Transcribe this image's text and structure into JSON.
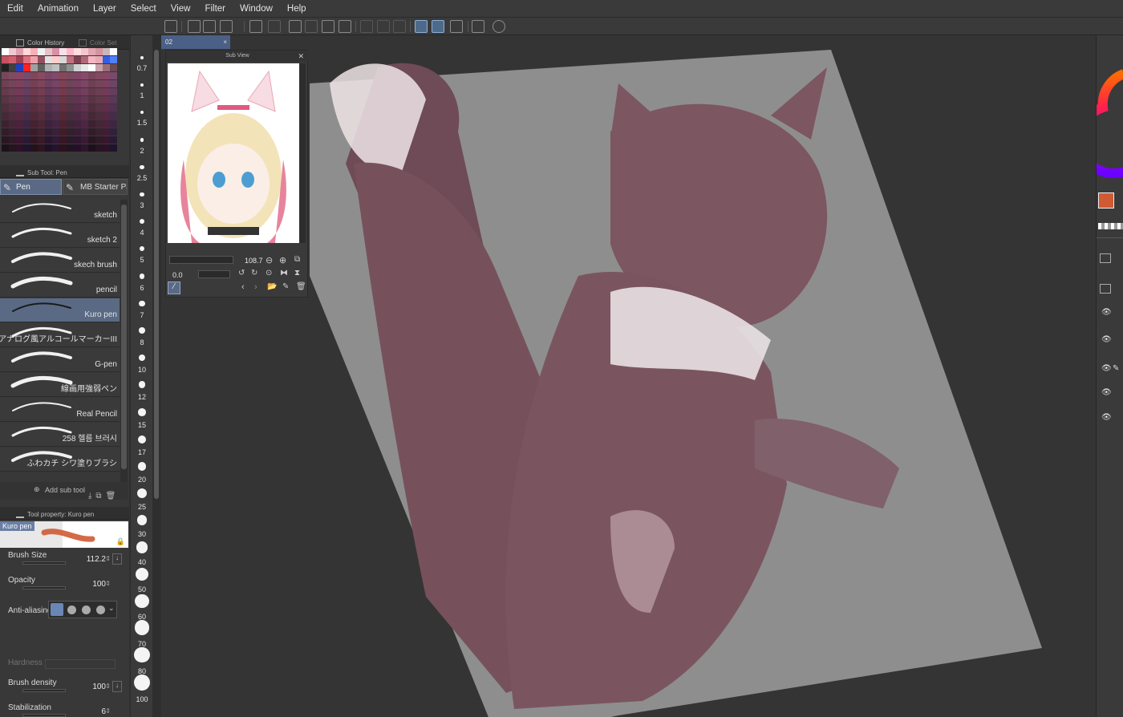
{
  "menu": {
    "items": [
      "Edit",
      "Animation",
      "Layer",
      "Select",
      "View",
      "Filter",
      "Window",
      "Help"
    ]
  },
  "left_panel": {
    "color_history_tab": "Color History",
    "color_set_tab": "Color Set",
    "subtool_header": "Sub Tool: Pen",
    "subtool_groups": [
      "Pen",
      "MB Starter Pa"
    ],
    "brushes": [
      {
        "label": "sketch"
      },
      {
        "label": "sketch 2"
      },
      {
        "label": "skech brush"
      },
      {
        "label": "pencil"
      },
      {
        "label": "Kuro pen"
      },
      {
        "label": "アナログ風アルコールマーカーIII"
      },
      {
        "label": "G-pen"
      },
      {
        "label": "線画用強弱ペン"
      },
      {
        "label": "Real Pencil"
      },
      {
        "label": "258 헬름 브러시"
      },
      {
        "label": "ふわカチ シワ塗りブラシ"
      }
    ],
    "selected_brush_index": 4,
    "add_subtool_label": "Add sub tool",
    "tool_property_header": "Tool property: Kuro pen",
    "preview_label": "Kuro pen",
    "properties": {
      "brush_size": {
        "label": "Brush Size",
        "value": "112.2"
      },
      "opacity": {
        "label": "Opacity",
        "value": "100"
      },
      "anti_aliasing": {
        "label": "Anti-aliasing"
      },
      "hardness": {
        "label": "Hardness"
      },
      "brush_density": {
        "label": "Brush density",
        "value": "100"
      },
      "stabilization": {
        "label": "Stabilization",
        "value": "6"
      }
    }
  },
  "size_column": {
    "values": [
      "0.7",
      "1",
      "1.5",
      "2",
      "2.5",
      "3",
      "4",
      "5",
      "6",
      "7",
      "8",
      "10",
      "12",
      "15",
      "17",
      "20",
      "25",
      "30",
      "40",
      "50",
      "60",
      "70",
      "80",
      "100"
    ]
  },
  "canvas": {
    "document_tab": "02",
    "close_glyph": "×"
  },
  "subview": {
    "title": "Sub View",
    "zoom": "108.7",
    "rotation": "0.0"
  },
  "colors": {
    "accent_selected": "#5a6a85",
    "main_color": "#d05a33",
    "canvas_gray": "#8e8e8e",
    "figure_tone": "#7a5560"
  }
}
